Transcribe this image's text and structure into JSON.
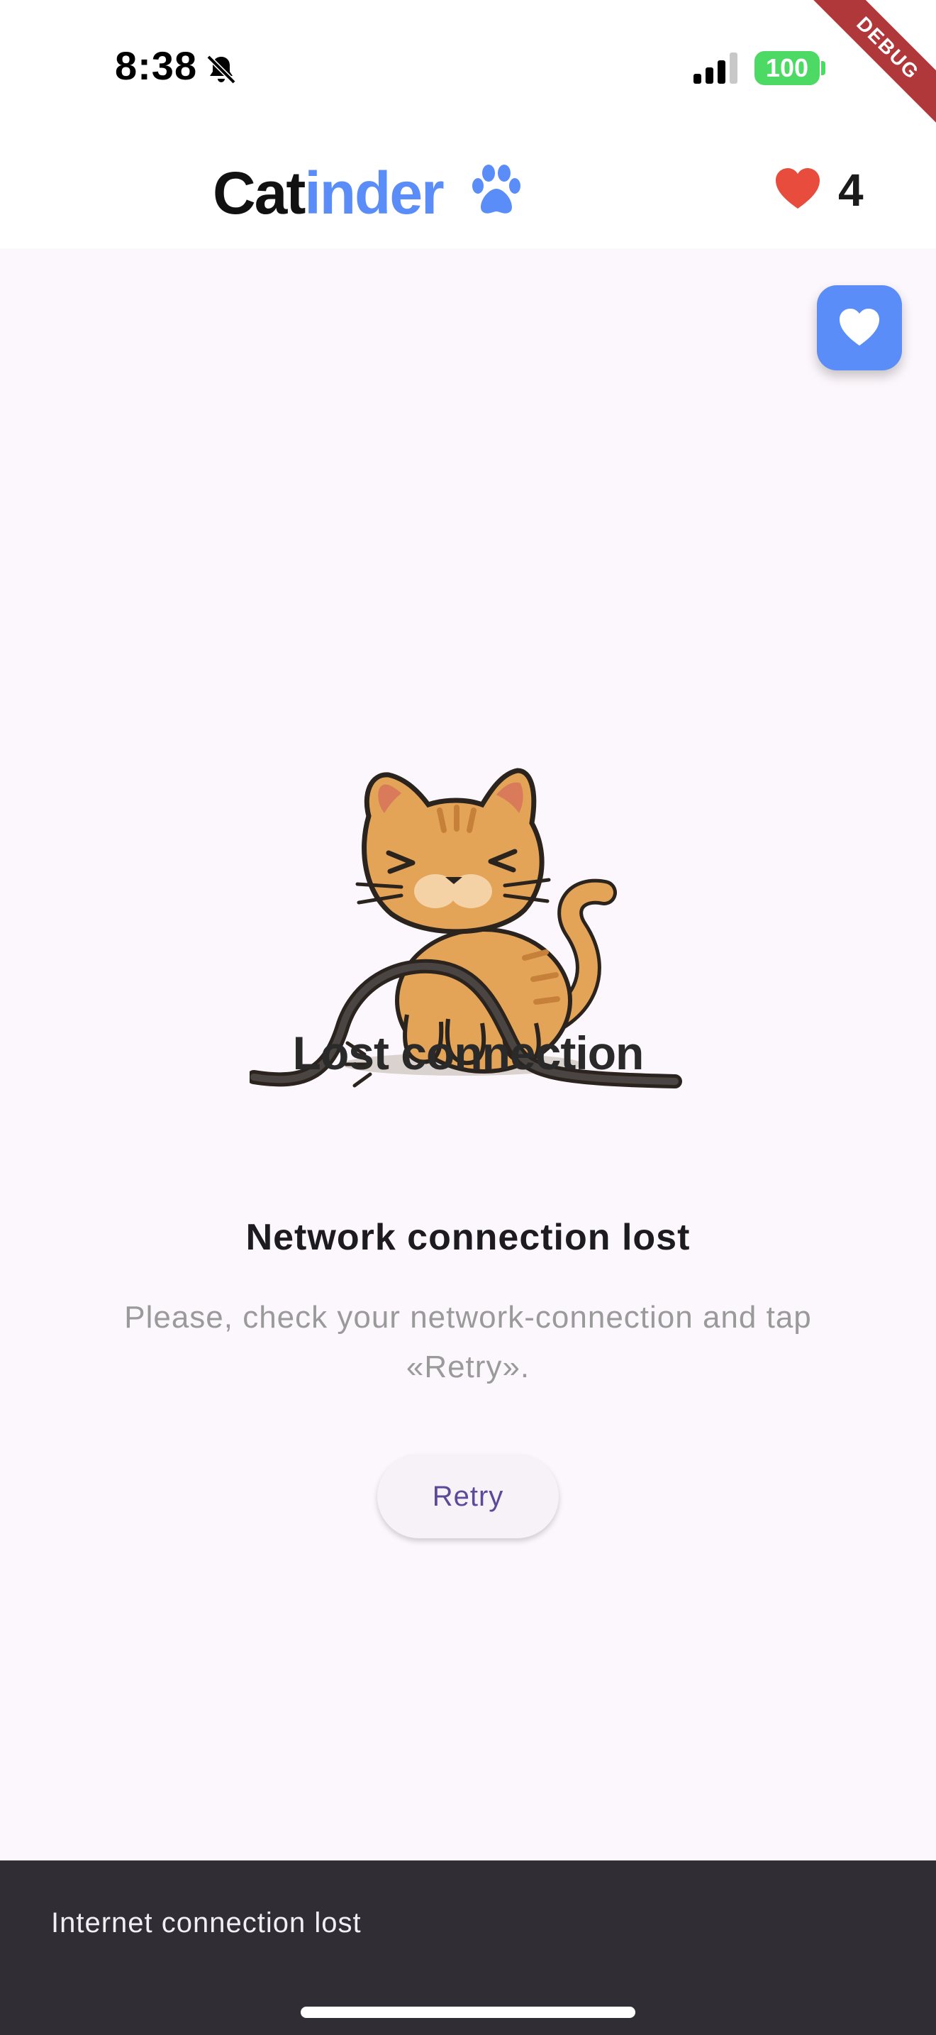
{
  "status_bar": {
    "time": "8:38",
    "battery_level": "100",
    "debug_banner": "DEBUG"
  },
  "app_bar": {
    "brand_part_a": "Cat",
    "brand_part_b": "inder",
    "likes_count": "4"
  },
  "main": {
    "illustration_caption": "Lost connection",
    "error_title": "Network connection lost",
    "error_message": "Please, check your network-connection and tap «Retry».",
    "retry_label": "Retry"
  },
  "snackbar": {
    "message": "Internet connection lost"
  },
  "colors": {
    "brand_blue": "#5a8df7",
    "heart_red": "#e74c3c",
    "battery_green": "#4cd964",
    "snackbar_bg": "#302e34",
    "page_bg": "#fcf7fc"
  },
  "icons": [
    "bell-slash-icon",
    "signal-icon",
    "battery-icon",
    "paw-icon",
    "heart-icon",
    "favorite-heart-icon"
  ]
}
